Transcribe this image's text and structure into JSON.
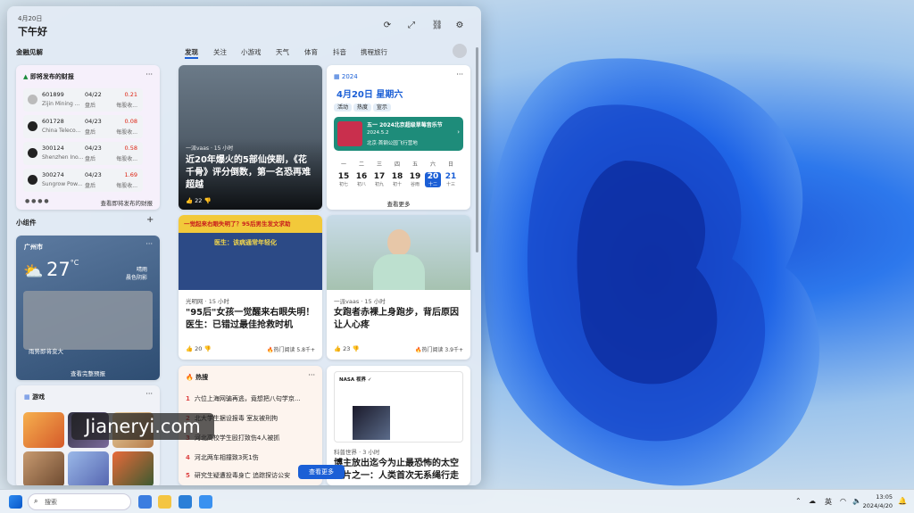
{
  "header": {
    "date": "4月20日",
    "greeting": "下午好"
  },
  "finance": {
    "section_title": "金融见解",
    "card_title": "即将发布的财报",
    "rows": [
      {
        "code": "601899",
        "name": "Zijin Mining ...",
        "date": "04/22",
        "when": "盘后",
        "value": "0.21",
        "label": "每股收..."
      },
      {
        "code": "601728",
        "name": "China Teleco...",
        "date": "04/23",
        "when": "盘后",
        "value": "0.08",
        "label": "每股收..."
      },
      {
        "code": "300124",
        "name": "Shenzhen Ino...",
        "date": "04/23",
        "when": "盘后",
        "value": "0.58",
        "label": "每股收..."
      },
      {
        "code": "300274",
        "name": "Sungrow Pow...",
        "date": "04/23",
        "when": "盘后",
        "value": "1.69",
        "label": "每股收..."
      }
    ],
    "footer_link": "查看即将发布的财报"
  },
  "widgets_title": "小组件",
  "weather": {
    "city": "广州市",
    "temp": "27",
    "unit": "°C",
    "cond": "晴雨",
    "cond2": "晨色阴影",
    "alert": "雨势即将变大",
    "link": "查看完整预报"
  },
  "games": {
    "title": "游戏"
  },
  "tabs": [
    "发现",
    "关注",
    "小游戏",
    "天气",
    "体育",
    "抖音",
    "携程旅行"
  ],
  "news1": {
    "source": "一派vaas · 15 小时",
    "title": "近20年爆火的5部仙侠剧，《花千骨》评分倒数，第一名恐再难超越",
    "likes": "22"
  },
  "calendar": {
    "year": "2024",
    "date": "4月20日 星期六",
    "chips": [
      "活动",
      "热度",
      "宣示"
    ],
    "event_title": "五一 2024北京超级草莓音乐节",
    "event_date": "2024.5.2",
    "event_place": "北京·首钢公园飞行营地",
    "days": [
      {
        "n": "15",
        "s": "初七"
      },
      {
        "n": "16",
        "s": "初八"
      },
      {
        "n": "17",
        "s": "初九"
      },
      {
        "n": "18",
        "s": "初十"
      },
      {
        "n": "19",
        "s": "谷雨"
      },
      {
        "n": "20",
        "s": "十二"
      },
      {
        "n": "21",
        "s": "十三"
      }
    ],
    "weekdays": [
      "一",
      "二",
      "三",
      "四",
      "五",
      "六",
      "日"
    ],
    "more": "查看更多"
  },
  "news2": {
    "banner": "一觉起来右眼失明了？95后男生发文求助",
    "sub": "医生：该病通常年轻化",
    "source": "光明网 · 15 小时",
    "title": "\"95后\"女孩一觉醒来右眼失明！医生：已错过最佳抢救时机",
    "likes": "20",
    "hot": "热门阅读 5.8千+"
  },
  "news3": {
    "source": "一派vaas · 15 小时",
    "title": "女跑者赤裸上身跑步，背后原因让人心疼",
    "likes": "23",
    "hot": "热门阅读 3.9千+"
  },
  "hot": {
    "title": "热搜",
    "items": [
      "六位上海网骗再逃，竟想把八句学京...",
      "北大学生据设报毒 室友被刑拘",
      "河北高校学生殴打致伤4人被抓",
      "河北两车相撞致3死1伤",
      "研究生疑遭投毒身亡 追踪探访公安"
    ]
  },
  "news4": {
    "tweet_author": "NASA 视界 ✓",
    "source": "科普世界 · 3 小时",
    "title": "博主放出迄今为止最恐怖的太空照片之一：人类首次无系绳行走"
  },
  "see_more": "查看更多",
  "taskbar": {
    "search": "搜索",
    "lang": "英",
    "time": "13:05",
    "date": "2024/4/20"
  },
  "watermark": "Jianeryi.com"
}
